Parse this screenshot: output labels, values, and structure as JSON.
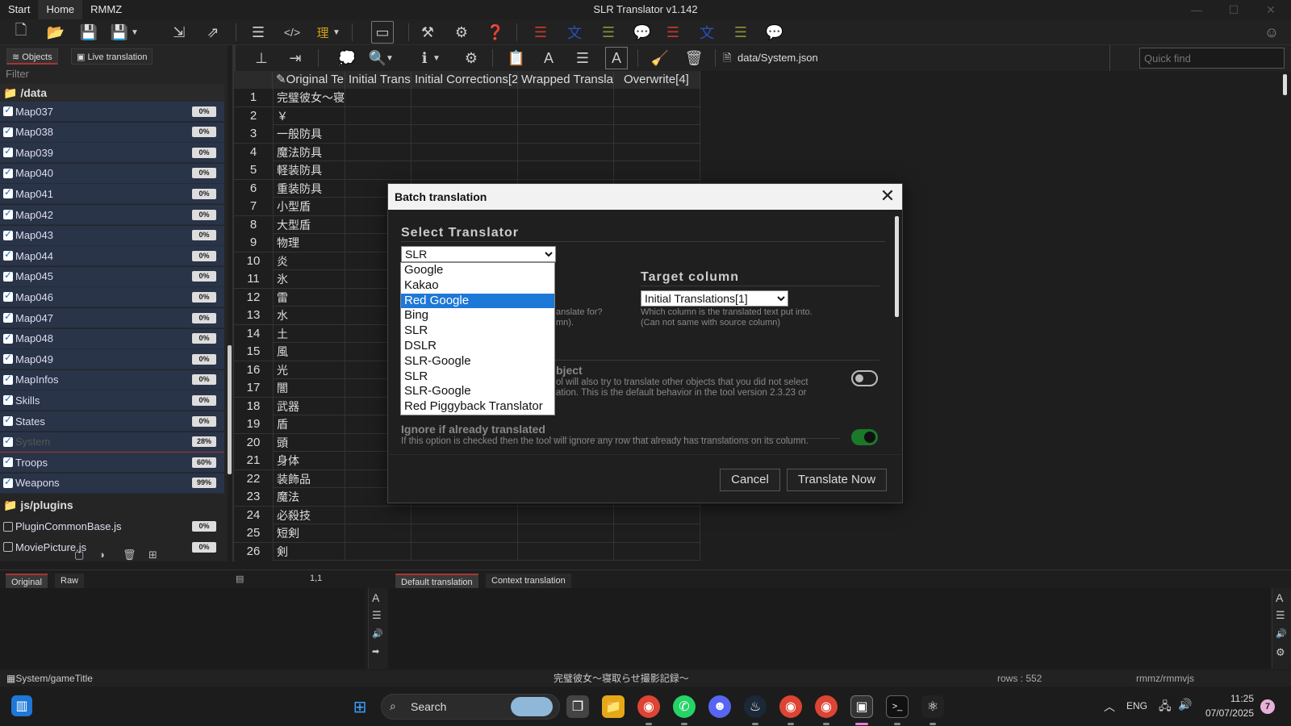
{
  "app": {
    "title": "SLR Translator v1.142",
    "menus": [
      "Start",
      "Home",
      "RMMZ"
    ]
  },
  "file_path": "data/System.json",
  "quick_find": {
    "placeholder": "Quick find"
  },
  "left_panel": {
    "tabs": [
      "Objects",
      "Live translation"
    ],
    "filter_placeholder": "Filter",
    "folder_data": "/data",
    "folder_plugins": "js/plugins",
    "items": [
      {
        "name": "Map037",
        "pct": "0%",
        "checked": true
      },
      {
        "name": "Map038",
        "pct": "0%",
        "checked": true
      },
      {
        "name": "Map039",
        "pct": "0%",
        "checked": true
      },
      {
        "name": "Map040",
        "pct": "0%",
        "checked": true
      },
      {
        "name": "Map041",
        "pct": "0%",
        "checked": true
      },
      {
        "name": "Map042",
        "pct": "0%",
        "checked": true
      },
      {
        "name": "Map043",
        "pct": "0%",
        "checked": true
      },
      {
        "name": "Map044",
        "pct": "0%",
        "checked": true
      },
      {
        "name": "Map045",
        "pct": "0%",
        "checked": true
      },
      {
        "name": "Map046",
        "pct": "0%",
        "checked": true
      },
      {
        "name": "Map047",
        "pct": "0%",
        "checked": true
      },
      {
        "name": "Map048",
        "pct": "0%",
        "checked": true
      },
      {
        "name": "Map049",
        "pct": "0%",
        "checked": true
      },
      {
        "name": "MapInfos",
        "pct": "0%",
        "checked": true
      },
      {
        "name": "Skills",
        "pct": "0%",
        "checked": true
      },
      {
        "name": "States",
        "pct": "0%",
        "checked": true
      },
      {
        "name": "System",
        "pct": "28%",
        "checked": true,
        "selected": true
      },
      {
        "name": "Troops",
        "pct": "60%",
        "checked": true
      },
      {
        "name": "Weapons",
        "pct": "99%",
        "checked": true
      }
    ],
    "plugin_items": [
      {
        "name": "PluginCommonBase.js",
        "pct": "0%",
        "checked": false
      },
      {
        "name": "MoviePicture.js",
        "pct": "0%",
        "checked": false
      }
    ]
  },
  "grid": {
    "headers": [
      "Original Te",
      "Initial Trans",
      "Initial Corrections[2",
      "Wrapped Translati",
      "Overwrite[4]"
    ],
    "rows": [
      {
        "n": "1",
        "t": "完璧彼女～寝"
      },
      {
        "n": "2",
        "t": "￥"
      },
      {
        "n": "3",
        "t": "一般防具"
      },
      {
        "n": "4",
        "t": "魔法防具"
      },
      {
        "n": "5",
        "t": "軽装防具"
      },
      {
        "n": "6",
        "t": "重装防具"
      },
      {
        "n": "7",
        "t": "小型盾"
      },
      {
        "n": "8",
        "t": "大型盾"
      },
      {
        "n": "9",
        "t": "物理"
      },
      {
        "n": "10",
        "t": "炎"
      },
      {
        "n": "11",
        "t": "氷"
      },
      {
        "n": "12",
        "t": "雷"
      },
      {
        "n": "13",
        "t": "水"
      },
      {
        "n": "14",
        "t": "土"
      },
      {
        "n": "15",
        "t": "風"
      },
      {
        "n": "16",
        "t": "光"
      },
      {
        "n": "17",
        "t": "闇"
      },
      {
        "n": "18",
        "t": "武器"
      },
      {
        "n": "19",
        "t": "盾"
      },
      {
        "n": "20",
        "t": "頭"
      },
      {
        "n": "21",
        "t": "身体"
      },
      {
        "n": "22",
        "t": "装飾品"
      },
      {
        "n": "23",
        "t": "魔法"
      },
      {
        "n": "24",
        "t": "必殺技"
      },
      {
        "n": "25",
        "t": "短剣"
      },
      {
        "n": "26",
        "t": "剣"
      }
    ]
  },
  "dialog": {
    "title": "Batch translation",
    "select_translator_label": "Select Translator",
    "translator_value": "SLR",
    "dropdown_options": [
      "Google",
      "Kakao",
      "Red Google",
      "Bing",
      "SLR",
      "DSLR",
      "SLR-Google",
      "SLR",
      "SLR-Google",
      "Red Piggyback Translator"
    ],
    "highlighted_option": "Red Google",
    "target_column_label": "Target column",
    "target_column_value": "Initial Translations[1]",
    "target_desc_1": "Which column is the translated text put into.",
    "target_desc_2": "(Can not same with source column)",
    "source_desc_1": "anslate for?",
    "source_desc_2": "mn).",
    "other_object_heading": "bject",
    "other_object_desc_1": "ol will also try to translate other objects that you did not select",
    "other_object_desc_2": "ation. This is the default behavior in the tool version 2.3.23 or",
    "ignore_heading": "Ignore if already translated",
    "ignore_desc": "If this option is checked then the tool will ignore any row that already has translations on its column.",
    "cancel_label": "Cancel",
    "translate_label": "Translate Now"
  },
  "bottom": {
    "left_tabs": [
      "Original",
      "Raw"
    ],
    "cursor_pos": "1,1",
    "right_tabs": [
      "Default translation",
      "Context translation"
    ]
  },
  "status": {
    "path": "System/gameTitle",
    "text": "完璧彼女～寝取らせ撮影記録～",
    "rows": "rows : 552",
    "engine": "rmmz/rmmvjs"
  },
  "taskbar": {
    "search_label": "Search",
    "lang": "ENG",
    "time": "11:25",
    "date": "07/07/2025",
    "badge": "7"
  },
  "colors": {
    "accent": "#1e78d7",
    "toggle_on": "#1a7a2a",
    "tree_row_bg": "#2a3448"
  }
}
